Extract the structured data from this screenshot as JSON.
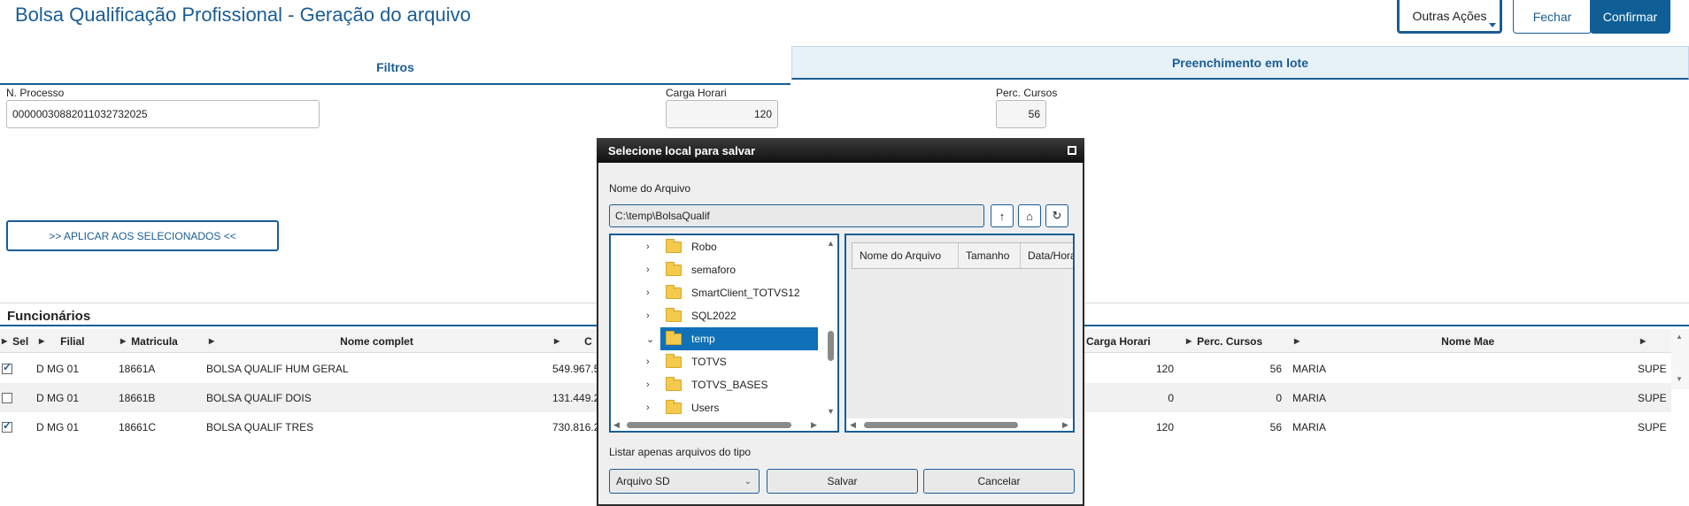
{
  "page": {
    "title": "Bolsa Qualificação Profissional - Geração do arquivo",
    "buttons": {
      "outras": "Outras Ações",
      "fechar": "Fechar",
      "confirmar": "Confirmar"
    },
    "tabs": [
      {
        "label": "Filtros"
      },
      {
        "label": "Preenchimento em lote"
      }
    ]
  },
  "filters": {
    "processo_label": "N. Processo",
    "processo_value": "000000308820110327320 25",
    "carga_label": "Carga Horari",
    "carga_value": "120",
    "perc_label": "Perc. Cursos",
    "perc_value": "56",
    "apply_label": ">> APLICAR AOS SELECIONADOS <<"
  },
  "grid": {
    "title": "Funcionários",
    "columns": [
      "Sel",
      "Filial",
      "Matricula",
      "Nome complet",
      "C",
      "Carga Horari",
      "Perc. Cursos",
      "Nome Mae"
    ],
    "rows": [
      {
        "checked": true,
        "filial": "D MG 01",
        "matricula": "18661A",
        "nome": "BOLSA QUALIF HUM GERAL",
        "valor": "549.967.5",
        "carga": "120",
        "perc": "56",
        "mae": "MARIA",
        "extra": "SUPE"
      },
      {
        "checked": false,
        "filial": "D MG 01",
        "matricula": "18661B",
        "nome": "BOLSA QUALIF DOIS",
        "valor": "131.449.2",
        "carga": "0",
        "perc": "0",
        "mae": "MARIA",
        "extra": "SUPE"
      },
      {
        "checked": true,
        "filial": "D MG 01",
        "matricula": "18661C",
        "nome": "BOLSA QUALIF TRES",
        "valor": "730.816.2",
        "carga": "120",
        "perc": "56",
        "mae": "MARIA",
        "extra": "SUPE"
      }
    ]
  },
  "modal": {
    "title": "Selecione local para salvar",
    "file_label": "Nome do Arquivo",
    "path": "C:\\temp\\BolsaQualif",
    "folders": [
      {
        "name": "Robo",
        "selected": false,
        "expanded": false
      },
      {
        "name": "semaforo",
        "selected": false,
        "expanded": false
      },
      {
        "name": "SmartClient_TOTVS12",
        "selected": false,
        "expanded": false
      },
      {
        "name": "SQL2022",
        "selected": false,
        "expanded": false
      },
      {
        "name": "temp",
        "selected": true,
        "expanded": true
      },
      {
        "name": "TOTVS",
        "selected": false,
        "expanded": false
      },
      {
        "name": "TOTVS_BASES",
        "selected": false,
        "expanded": false
      },
      {
        "name": "Users",
        "selected": false,
        "expanded": false
      }
    ],
    "list_columns": [
      "Nome do Arquivo",
      "Tamanho",
      "Data/Hora"
    ],
    "type_label": "Listar apenas arquivos do tipo",
    "type_value": "Arquivo SD",
    "save_label": "Salvar",
    "cancel_label": "Cancelar"
  }
}
